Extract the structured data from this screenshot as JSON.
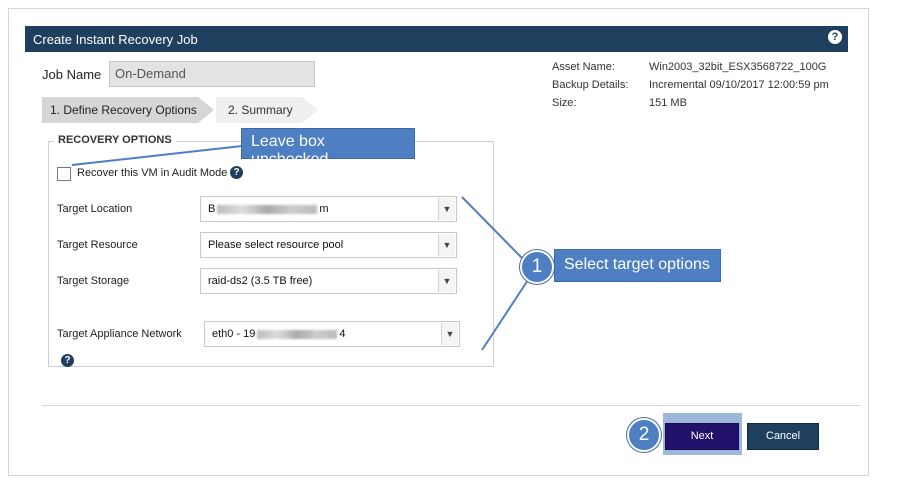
{
  "dialog": {
    "title": "Create Instant Recovery Job",
    "help_icon": "question-circle-icon"
  },
  "job": {
    "name_label": "Job Name",
    "name_value": "On-Demand"
  },
  "steps": [
    {
      "label": "1. Define Recovery Options"
    },
    {
      "label": "2. Summary"
    }
  ],
  "asset": [
    {
      "key": "Asset Name:",
      "value": "Win2003_32bit_ESX3568722_100G"
    },
    {
      "key": "Backup Details:",
      "value": "Incremental 09/10/2017 12:00:59 pm"
    },
    {
      "key": "Size:",
      "value": "151 MB"
    }
  ],
  "recovery": {
    "legend": "RECOVERY OPTIONS",
    "audit_label": "Recover this VM in Audit Mode",
    "location_label": "Target Location",
    "location_prefix": "B",
    "location_suffix": "m",
    "resource_label": "Target Resource",
    "resource_value": "Please select resource pool",
    "storage_label": "Target Storage",
    "storage_value": "raid-ds2 (3.5 TB free)",
    "network_label": "Target Appliance Network",
    "network_prefix": "eth0 - 19",
    "network_suffix": "4"
  },
  "buttons": {
    "next": "Next",
    "cancel": "Cancel"
  },
  "callouts": {
    "leave_box": "Leave box unchecked",
    "select_target": "Select target options",
    "badge1": "1",
    "badge2": "2"
  },
  "colors": {
    "header": "#1f3f5f",
    "next_button": "#21116b",
    "callout": "#4f7fc3"
  }
}
